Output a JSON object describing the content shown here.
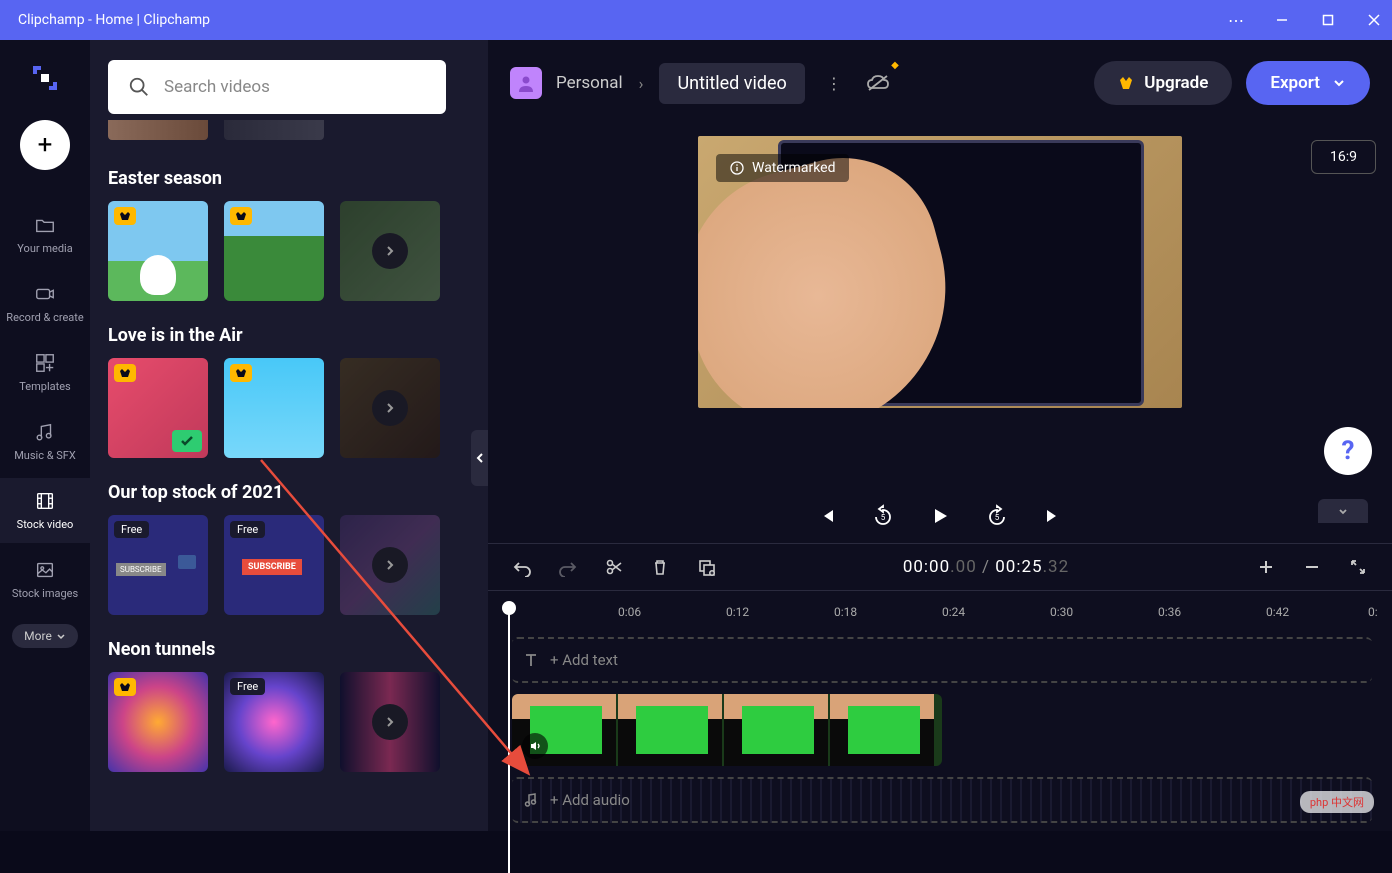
{
  "window": {
    "title": "Clipchamp - Home | Clipchamp"
  },
  "sidebar": {
    "items": [
      {
        "label": "Your media"
      },
      {
        "label": "Record & create"
      },
      {
        "label": "Templates"
      },
      {
        "label": "Music & SFX"
      },
      {
        "label": "Stock video"
      },
      {
        "label": "Stock images"
      }
    ],
    "more": "More"
  },
  "panel": {
    "search_placeholder": "Search videos",
    "sections": [
      {
        "title": "Easter season"
      },
      {
        "title": "Love is in the Air"
      },
      {
        "title": "Our top stock of 2021"
      },
      {
        "title": "Neon tunnels"
      }
    ],
    "free_badge": "Free"
  },
  "topbar": {
    "workspace": "Personal",
    "project_title": "Untitled video",
    "upgrade": "Upgrade",
    "export": "Export"
  },
  "preview": {
    "watermark": "Watermarked",
    "aspect": "16:9"
  },
  "timeline": {
    "current": "00:00",
    "current_frac": ".00",
    "total": "00:25",
    "total_frac": ".32",
    "ticks": [
      "0:06",
      "0:12",
      "0:18",
      "0:24",
      "0:30",
      "0:36",
      "0:42",
      "0:"
    ],
    "add_text": "+ Add text",
    "add_audio": "+ Add audio"
  },
  "corner_wm": "php 中文网"
}
